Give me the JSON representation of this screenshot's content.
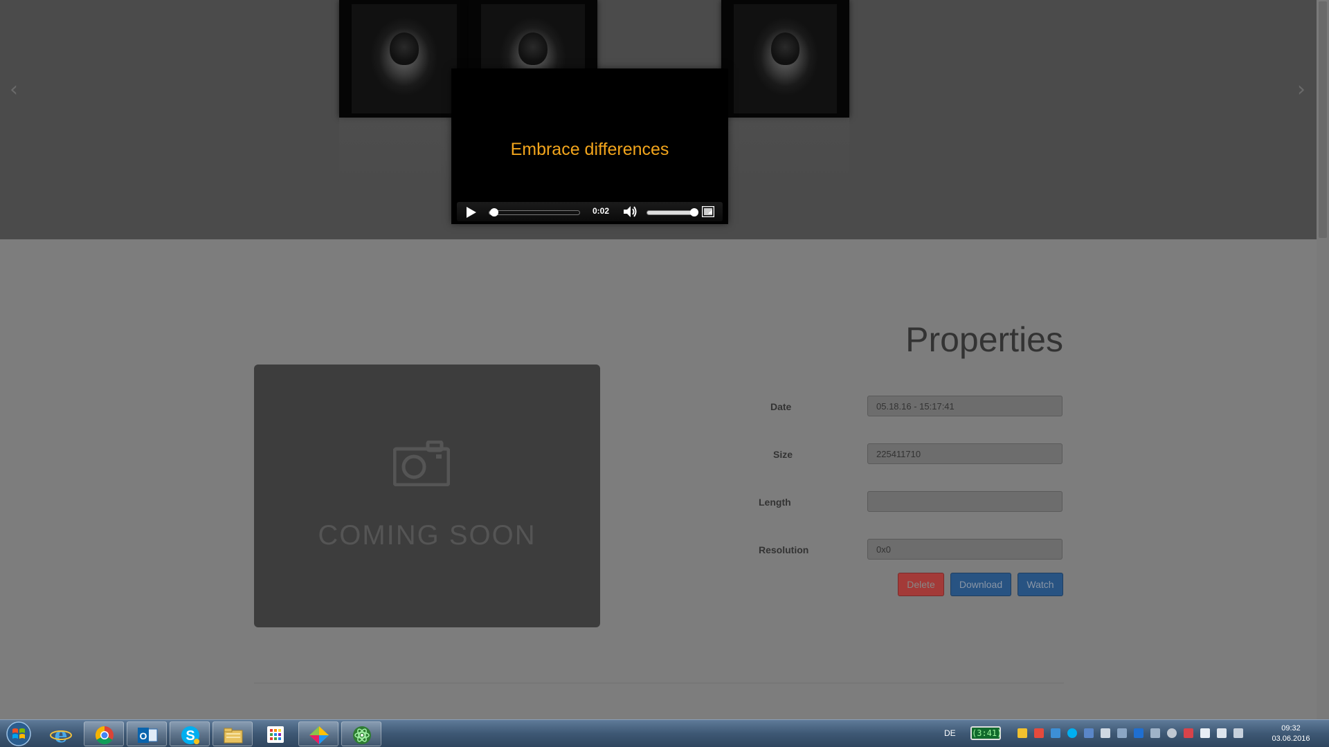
{
  "carousel": {
    "prev_glyph": "‹",
    "next_glyph": "›",
    "slides": [
      "slide-1",
      "slide-2",
      "slide-3"
    ],
    "player": {
      "caption": "Embrace differences",
      "time": "0:02",
      "progress_fraction": 0.05,
      "volume_fraction": 1.0,
      "caption_color": "#f2a51c"
    }
  },
  "preview": {
    "icon": "camera-icon",
    "coming_soon": "COMING SOON"
  },
  "properties": {
    "title": "Properties",
    "fields": [
      {
        "label": "Date",
        "value": "05.18.16 - 15:17:41"
      },
      {
        "label": "Size",
        "value": "225411710"
      },
      {
        "label": "Length",
        "value": ""
      },
      {
        "label": "Resolution",
        "value": "0x0"
      }
    ],
    "buttons": {
      "delete": "Delete",
      "download": "Download",
      "watch": "Watch"
    },
    "colors": {
      "delete": "#a33a38",
      "primary": "#285382"
    }
  },
  "taskbar": {
    "apps": [
      "internet-explorer-icon",
      "chrome-icon",
      "outlook-icon",
      "skype-icon",
      "file-explorer-icon",
      "app-grid-icon",
      "maps-icon",
      "atom-icon"
    ],
    "language": "DE",
    "battery": "(3:41)",
    "clock_time": "09:32",
    "clock_date": "03.06.2016"
  }
}
